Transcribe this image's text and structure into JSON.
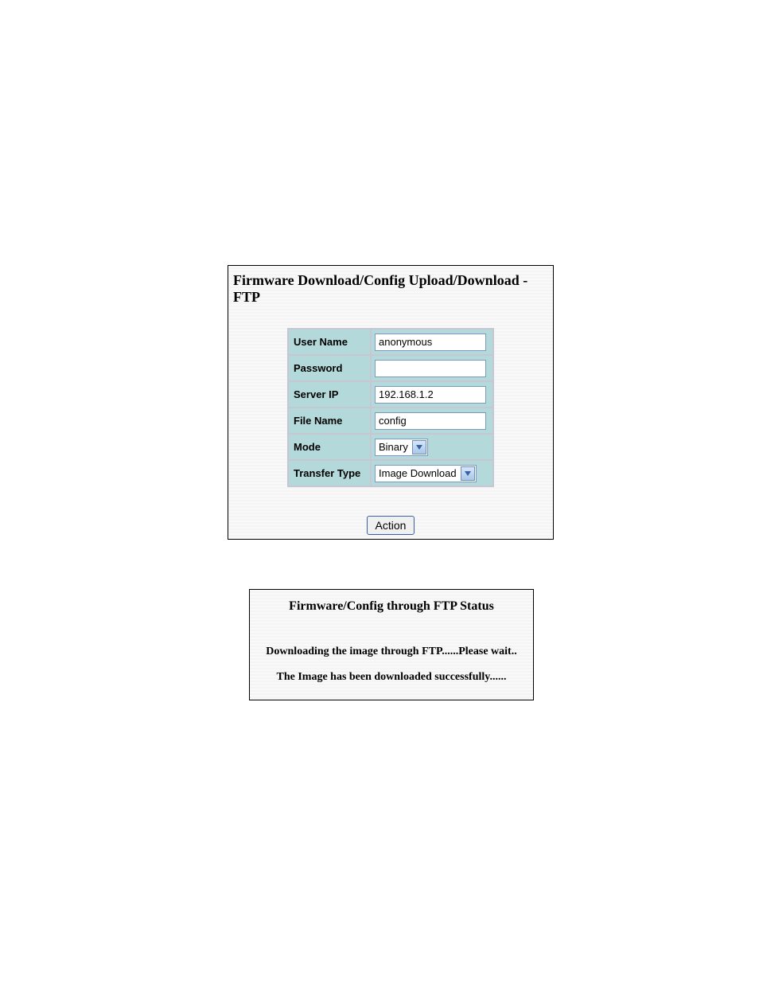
{
  "form": {
    "title": "Firmware Download/Config Upload/Download - FTP",
    "fields": {
      "username": {
        "label": "User Name",
        "value": "anonymous"
      },
      "password": {
        "label": "Password",
        "value": ""
      },
      "server_ip": {
        "label": "Server IP",
        "value": "192.168.1.2"
      },
      "file_name": {
        "label": "File Name",
        "value": "config"
      },
      "mode": {
        "label": "Mode",
        "value": "Binary"
      },
      "transfer_type": {
        "label": "Transfer Type",
        "value": "Image Download"
      }
    },
    "action_label": "Action"
  },
  "status": {
    "title": "Firmware/Config through FTP Status",
    "line1": "Downloading the image through FTP......Please wait..",
    "line2": "The Image has been downloaded successfully......"
  }
}
